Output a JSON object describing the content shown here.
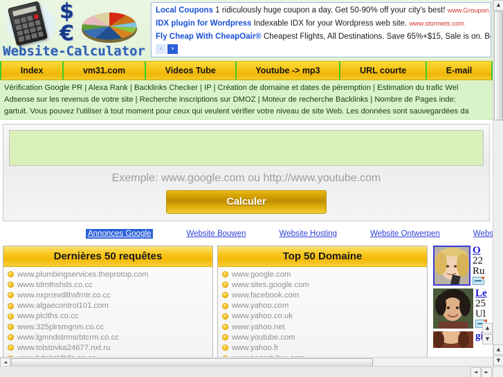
{
  "brand": {
    "name": "Website-Calculator",
    "dollar": "$",
    "euro": "€"
  },
  "ads_banner": {
    "items": [
      {
        "title": "Local Coupons",
        "text": "1 ridiculously huge coupon a day. Get 50-90% off your city's best!",
        "url": "www.Groupon.com"
      },
      {
        "title": "IDX plugin for Wordpress",
        "text": "Indexable IDX for your Wordpress web site.",
        "url": "www.stormets.com"
      },
      {
        "title": "Fly Cheap With CheapOair®",
        "text": "Cheapest Flights, All Destinations. Save 65%+$15, Sale is on. Book N",
        "url": ""
      }
    ],
    "prev_label": "‹",
    "next_label": "›"
  },
  "nav": {
    "items": [
      {
        "label": "Index"
      },
      {
        "label": "vm31.com"
      },
      {
        "label": "Videos Tube"
      },
      {
        "label": "Youtube -> mp3"
      },
      {
        "label": "URL courte"
      },
      {
        "label": "E-mail "
      }
    ]
  },
  "description": {
    "line1": "Vérification Google PR | Alexa Rank | Backlinks Checker | IP | Création de domaine et dates de péremption | Estimation du trafic Wel",
    "line2": "Adsense sur les revenus de votre site | Recherche inscriptions sur  DMOZ | Moteur de recherche Backlinks | Nombre de Pages inde:",
    "line3": "gartuit. Vous pouvez l'utiliser à tout moment pour ceux qui veulent vérifier votre niveau de site Web. Les données sont sauvegardées da"
  },
  "form": {
    "url_value": "",
    "url_placeholder": "",
    "example": "Exemple: www.google.com ou http://www.youtube.com",
    "submit_label": "Calculer"
  },
  "google_ads_links": {
    "lead": "Annonces Google",
    "links": [
      {
        "label": "Website Bouwen"
      },
      {
        "label": "Website Hosting"
      },
      {
        "label": "Website Ontwerpen"
      },
      {
        "label": "Website A"
      }
    ]
  },
  "panels": [
    {
      "title": "Dernières 50 requêtes",
      "items": [
        "www.plumbingservices.theprotop.com",
        "www.tdmthshds.co.cc",
        "www.nxpnsvdllhsfrntr.co.cc",
        "www.algaecontrol101.com",
        "www.plclths.co.cc",
        "www.325plrsmgnm.co.cc",
        "www.lgmndstrmsrbtcrm.co.cc",
        "www.tolstovka24677.nxt.ru",
        "www.bdnbsktblls.co.cc"
      ]
    },
    {
      "title": "Top 50 Domaine",
      "items": [
        "www.google.com",
        "www.sites.google.com",
        "www.facebook.com",
        "www.yahoo.com",
        "www.yahoo.co.uk",
        "www.yahoo.net",
        "www.youtube.com",
        "www.yahoo.fr",
        "www.search.live.com"
      ]
    }
  ],
  "rail": {
    "entries": [
      {
        "title": "O",
        "line1": "22",
        "line2": "Ru"
      },
      {
        "title": "Le",
        "line1": "25",
        "line2": "Ul"
      },
      {
        "title": "gi",
        "line1": "",
        "line2": ""
      }
    ]
  },
  "scrollbars": {
    "up_arrow": "▲",
    "down_arrow": "▼",
    "left_arrow": "◄",
    "right_arrow": "►"
  },
  "colors": {
    "nav_gold": "#f7c71a",
    "nav_divider_green": "#39d02b",
    "desc_green": "#d9f3c8",
    "input_green": "#d9f0bb",
    "link_blue": "#2b3fd9",
    "ad_title_blue": "#1a4fd6",
    "ad_url_red": "#d0322a",
    "brand_blue": "#2f5fae"
  }
}
